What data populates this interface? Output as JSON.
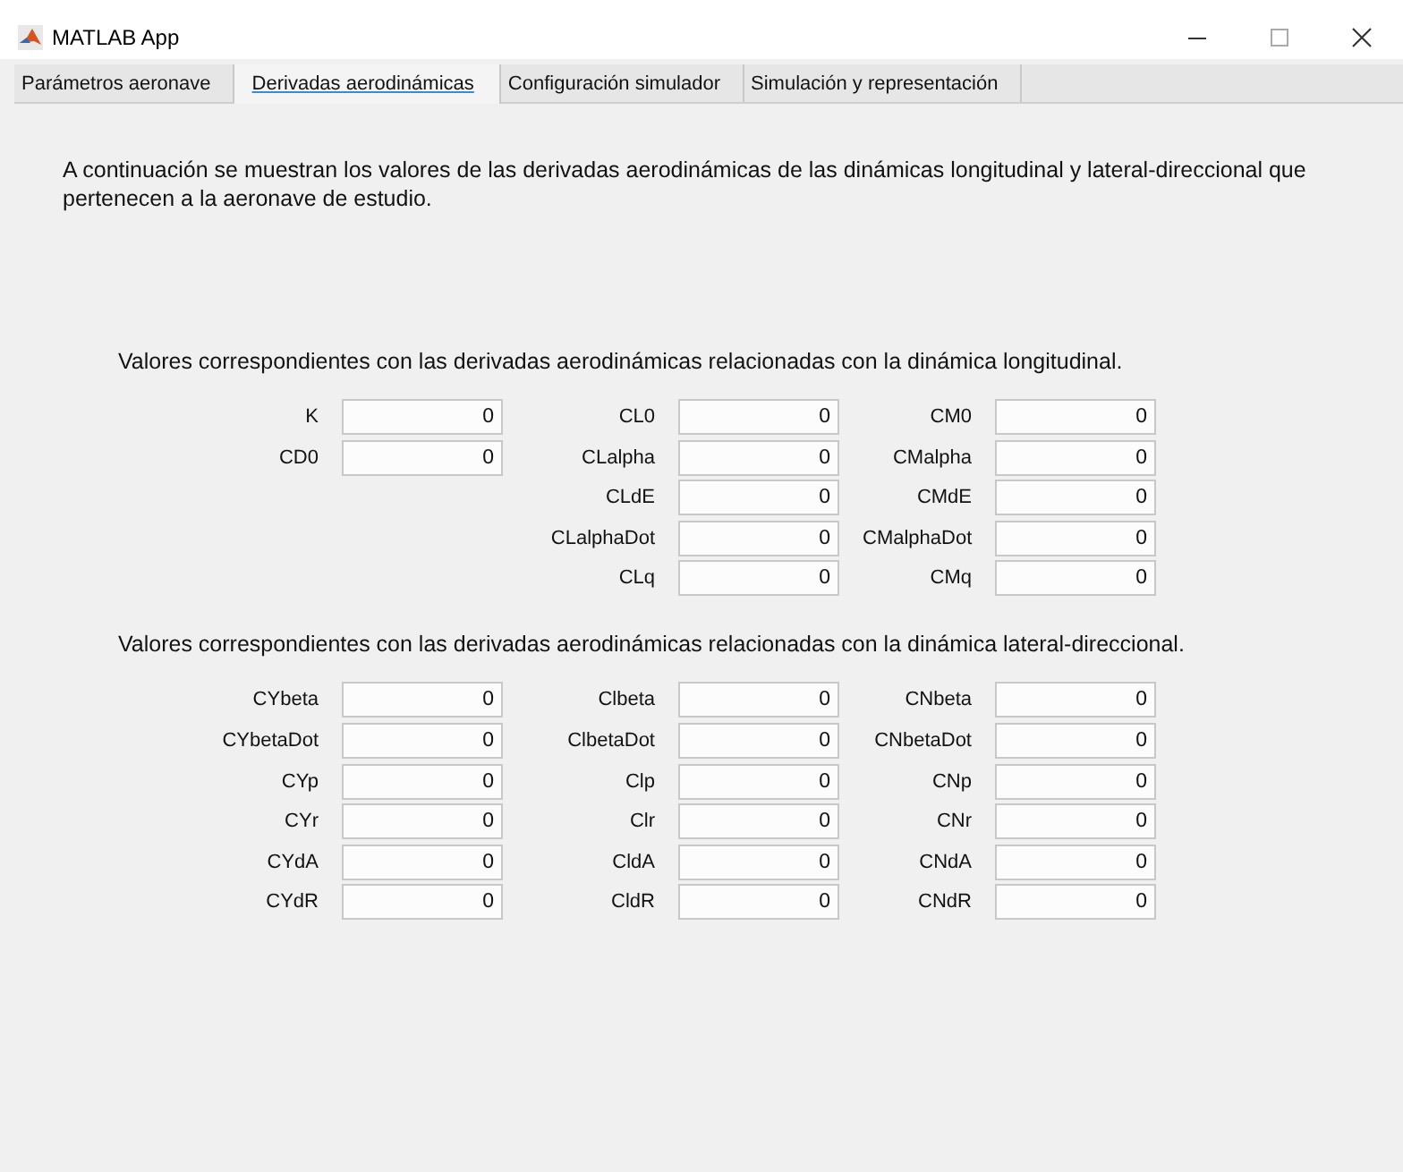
{
  "window": {
    "title": "MATLAB App"
  },
  "tabs": [
    {
      "label": "Parámetros aeronave",
      "selected": false
    },
    {
      "label": "Derivadas aerodinámicas",
      "selected": true
    },
    {
      "label": "Configuración simulador",
      "selected": false
    },
    {
      "label": "Simulación y representación",
      "selected": false
    }
  ],
  "intro": "A continuación se muestran los valores de las derivadas aerodinámicas de las dinámicas longitudinal y lateral-direccional que pertenecen a la aeronave de estudio.",
  "sections": [
    {
      "title": "Valores correspondientes con las derivadas aerodinámicas relacionadas con la dinámica longitudinal.",
      "columns": [
        [
          {
            "label": "K",
            "value": "0"
          },
          {
            "label": "CD0",
            "value": "0"
          }
        ],
        [
          {
            "label": "CL0",
            "value": "0"
          },
          {
            "label": "CLalpha",
            "value": "0"
          },
          {
            "label": "CLdE",
            "value": "0"
          },
          {
            "label": "CLalphaDot",
            "value": "0"
          },
          {
            "label": "CLq",
            "value": "0"
          }
        ],
        [
          {
            "label": "CM0",
            "value": "0"
          },
          {
            "label": "CMalpha",
            "value": "0"
          },
          {
            "label": "CMdE",
            "value": "0"
          },
          {
            "label": "CMalphaDot",
            "value": "0"
          },
          {
            "label": "CMq",
            "value": "0"
          }
        ]
      ]
    },
    {
      "title": "Valores correspondientes con las derivadas aerodinámicas relacionadas con la dinámica lateral-direccional.",
      "columns": [
        [
          {
            "label": "CYbeta",
            "value": "0"
          },
          {
            "label": "CYbetaDot",
            "value": "0"
          },
          {
            "label": "CYp",
            "value": "0"
          },
          {
            "label": "CYr",
            "value": "0"
          },
          {
            "label": "CYdA",
            "value": "0"
          },
          {
            "label": "CYdR",
            "value": "0"
          }
        ],
        [
          {
            "label": "Clbeta",
            "value": "0"
          },
          {
            "label": "ClbetaDot",
            "value": "0"
          },
          {
            "label": "Clp",
            "value": "0"
          },
          {
            "label": "Clr",
            "value": "0"
          },
          {
            "label": "CldA",
            "value": "0"
          },
          {
            "label": "CldR",
            "value": "0"
          }
        ],
        [
          {
            "label": "CNbeta",
            "value": "0"
          },
          {
            "label": "CNbetaDot",
            "value": "0"
          },
          {
            "label": "CNp",
            "value": "0"
          },
          {
            "label": "CNr",
            "value": "0"
          },
          {
            "label": "CNdA",
            "value": "0"
          },
          {
            "label": "CNdR",
            "value": "0"
          }
        ]
      ]
    }
  ]
}
